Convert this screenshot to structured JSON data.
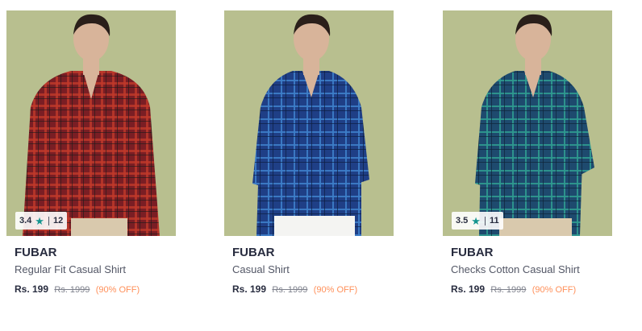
{
  "products": [
    {
      "brand": "FUBAR",
      "name": "Regular Fit Casual Shirt",
      "price": "Rs. 199",
      "mrp": "Rs. 1999",
      "discount": "(90% OFF)",
      "rating": "3.4",
      "rating_count": "12",
      "shirt_color": "#7a1e24",
      "check_color": "#c0392b"
    },
    {
      "brand": "FUBAR",
      "name": "Casual Shirt",
      "price": "Rs. 199",
      "mrp": "Rs. 1999",
      "discount": "(90% OFF)",
      "shirt_color": "#1f3f86",
      "check_color": "#3d7fc9"
    },
    {
      "brand": "FUBAR",
      "name": "Checks Cotton Casual Shirt",
      "price": "Rs. 199",
      "mrp": "Rs. 1999",
      "discount": "(90% OFF)",
      "rating": "3.5",
      "rating_count": "11",
      "shirt_color": "#1e4a6e",
      "check_color": "#2f9a8f"
    }
  ],
  "icons": {
    "rating_star": "star-icon"
  },
  "colors": {
    "background": "#b8bf8f",
    "rating_star": "#14958f",
    "discount": "#ff905a"
  }
}
